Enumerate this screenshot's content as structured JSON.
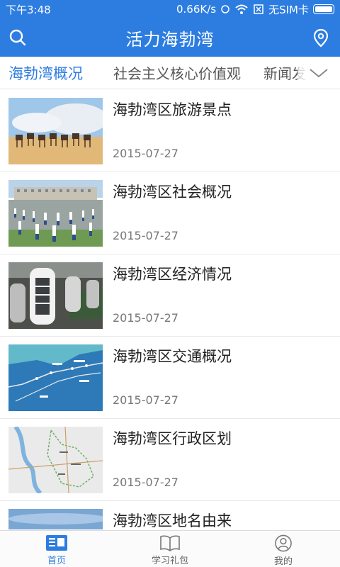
{
  "status_bar": {
    "time": "下午3:48",
    "network_speed": "0.66K/s",
    "sim_text": "无SIM卡"
  },
  "header": {
    "title": "活力海勃湾",
    "left_icon": "search-icon",
    "right_icon": "location-pin-icon"
  },
  "tabs": [
    {
      "label": "海勃湾概况",
      "active": true
    },
    {
      "label": "社会主义核心价值观",
      "active": false
    },
    {
      "label": "新闻发",
      "active": false
    }
  ],
  "tabs_more_icon": "chevron-down-icon",
  "articles": [
    {
      "title": "海勃湾区旅游景点",
      "date": "2015-07-27",
      "thumb": "camels-desert"
    },
    {
      "title": "海勃湾区社会概况",
      "date": "2015-07-27",
      "thumb": "school-exercise"
    },
    {
      "title": "海勃湾区经济情况",
      "date": "2015-07-27",
      "thumb": "factory-machines"
    },
    {
      "title": "海勃湾区交通概况",
      "date": "2015-07-27",
      "thumb": "transport-map"
    },
    {
      "title": "海勃湾区行政区划",
      "date": "2015-07-27",
      "thumb": "district-map"
    },
    {
      "title": "海勃湾区地名由来",
      "date": "",
      "thumb": "sky"
    }
  ],
  "bottom_nav": [
    {
      "label": "首页",
      "icon": "news-icon",
      "active": true
    },
    {
      "label": "学习礼包",
      "icon": "book-icon",
      "active": false
    },
    {
      "label": "我的",
      "icon": "user-icon",
      "active": false
    }
  ],
  "colors": {
    "accent": "#2d7de1"
  }
}
